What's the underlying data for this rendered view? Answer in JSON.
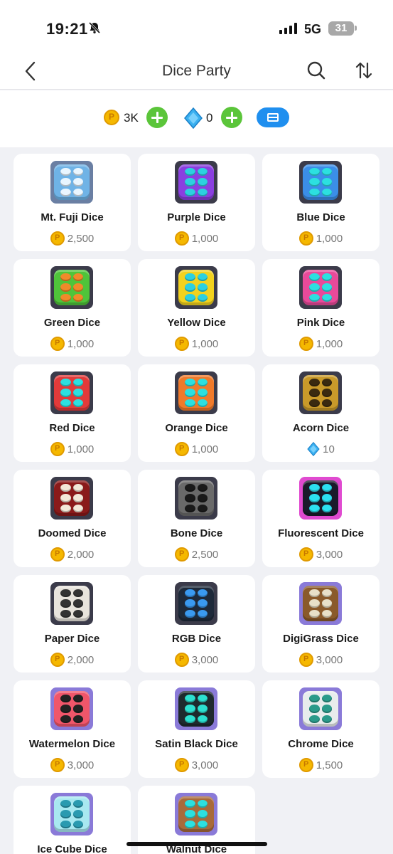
{
  "status_bar": {
    "time": "19:21",
    "network": "5G",
    "battery": "31"
  },
  "nav": {
    "title": "Dice Party"
  },
  "currency": {
    "coins": "3K",
    "gems": "0"
  },
  "items": [
    {
      "name": "Mt. Fuji Dice",
      "price": "2,500",
      "currency": "coin",
      "bg": "#4b6fa8",
      "face": "#6fb3e6",
      "pip": "#e9f6ff",
      "frame": "#6a7fa3"
    },
    {
      "name": "Purple Dice",
      "price": "1,000",
      "currency": "coin",
      "bg": "#3b3b4a",
      "face": "#8a3fe0",
      "pip": "#2cd0e0",
      "frame": "#3b3b4a"
    },
    {
      "name": "Blue Dice",
      "price": "1,000",
      "currency": "coin",
      "bg": "#3b3b4a",
      "face": "#3b8ee8",
      "pip": "#2ce0e0",
      "frame": "#3b3b4a"
    },
    {
      "name": "Green Dice",
      "price": "1,000",
      "currency": "coin",
      "bg": "#3b3b4a",
      "face": "#4fc43a",
      "pip": "#f08a2a",
      "frame": "#3b3b4a"
    },
    {
      "name": "Yellow Dice",
      "price": "1,000",
      "currency": "coin",
      "bg": "#3b3b4a",
      "face": "#f2d21e",
      "pip": "#2cd0e0",
      "frame": "#3b3b4a"
    },
    {
      "name": "Pink Dice",
      "price": "1,000",
      "currency": "coin",
      "bg": "#3b3b4a",
      "face": "#e84a9a",
      "pip": "#2ce0e0",
      "frame": "#3b3b4a"
    },
    {
      "name": "Red Dice",
      "price": "1,000",
      "currency": "coin",
      "bg": "#3b3b4a",
      "face": "#e23a3a",
      "pip": "#2ce0e0",
      "frame": "#3b3b4a"
    },
    {
      "name": "Orange Dice",
      "price": "1,000",
      "currency": "coin",
      "bg": "#3b3b4a",
      "face": "#f07a2a",
      "pip": "#2ce0e0",
      "frame": "#3b3b4a"
    },
    {
      "name": "Acorn Dice",
      "price": "10",
      "currency": "gem",
      "bg": "#3b3b4a",
      "face": "#c99a2a",
      "pip": "#3a2a10",
      "frame": "#3b3b4a"
    },
    {
      "name": "Doomed Dice",
      "price": "2,000",
      "currency": "coin",
      "bg": "#3b3b4a",
      "face": "#8a1a1a",
      "pip": "#f2e8d8",
      "frame": "#3b3b4a"
    },
    {
      "name": "Bone Dice",
      "price": "2,500",
      "currency": "coin",
      "bg": "#3b3b4a",
      "face": "#6a6a6a",
      "pip": "#1a1a1a",
      "frame": "#3b3b4a"
    },
    {
      "name": "Fluorescent Dice",
      "price": "3,000",
      "currency": "coin",
      "bg": "#3b3b4a",
      "face": "#1a1a2a",
      "pip": "#2ce0f0",
      "frame": "#e04ad0"
    },
    {
      "name": "Paper Dice",
      "price": "2,000",
      "currency": "coin",
      "bg": "#3b3b4a",
      "face": "#e8e4dc",
      "pip": "#333333",
      "frame": "#3b3b4a"
    },
    {
      "name": "RGB Dice",
      "price": "3,000",
      "currency": "coin",
      "bg": "#3b3b4a",
      "face": "#1e2a3a",
      "pip": "#3a9af0",
      "frame": "#3b3b4a"
    },
    {
      "name": "DigiGrass Dice",
      "price": "3,000",
      "currency": "coin",
      "bg": "#8a7ad8",
      "face": "#8a5a2a",
      "pip": "#e8e0c8",
      "frame": "#8a7ad8"
    },
    {
      "name": "Watermelon Dice",
      "price": "3,000",
      "currency": "coin",
      "bg": "#8a7ad8",
      "face": "#f0566a",
      "pip": "#222222",
      "frame": "#8a7ad8"
    },
    {
      "name": "Satin Black Dice",
      "price": "3,000",
      "currency": "coin",
      "bg": "#8a7ad8",
      "face": "#1e2a2e",
      "pip": "#2ce0d0",
      "frame": "#8a7ad8"
    },
    {
      "name": "Chrome Dice",
      "price": "1,500",
      "currency": "coin",
      "bg": "#8a7ad8",
      "face": "#e8ecec",
      "pip": "#2a9a8a",
      "frame": "#8a7ad8"
    },
    {
      "name": "Ice Cube Dice",
      "price": "",
      "currency": "coin",
      "bg": "#8a7ad8",
      "face": "#a8e8f0",
      "pip": "#2a9ab0",
      "frame": "#8a7ad8"
    },
    {
      "name": "Walnut Dice",
      "price": "",
      "currency": "coin",
      "bg": "#8a7ad8",
      "face": "#a86a3a",
      "pip": "#2ce0e0",
      "frame": "#8a7ad8"
    }
  ]
}
